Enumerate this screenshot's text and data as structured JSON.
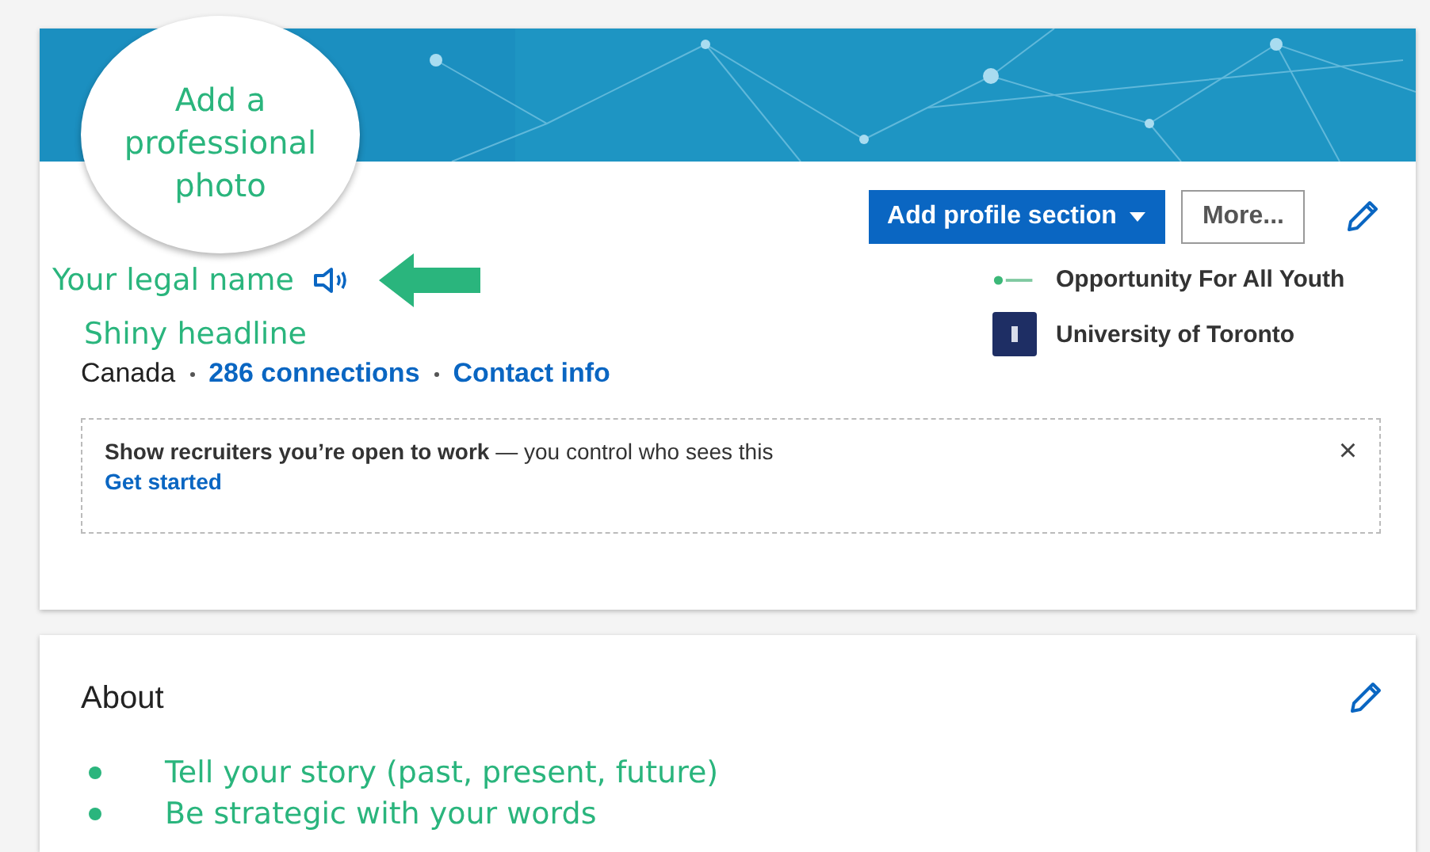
{
  "photo_prompt": "Add a professional photo",
  "profile": {
    "name": "Your legal name",
    "headline": "Shiny headline",
    "location": "Canada",
    "connections": "286 connections",
    "contact": "Contact info"
  },
  "actions": {
    "add_section": "Add profile section",
    "more": "More..."
  },
  "affiliations": [
    {
      "kind": "org",
      "label": "Opportunity For All Youth"
    },
    {
      "kind": "school",
      "label": "University of Toronto"
    }
  ],
  "open_to_work": {
    "text": "**Show recruiters you’re open to work** — you control who sees this",
    "link": "Get started",
    "close": "×"
  },
  "about": {
    "title": "About",
    "bullets": [
      "Tell your story (past, present, future)",
      "Be strategic with your words"
    ]
  }
}
